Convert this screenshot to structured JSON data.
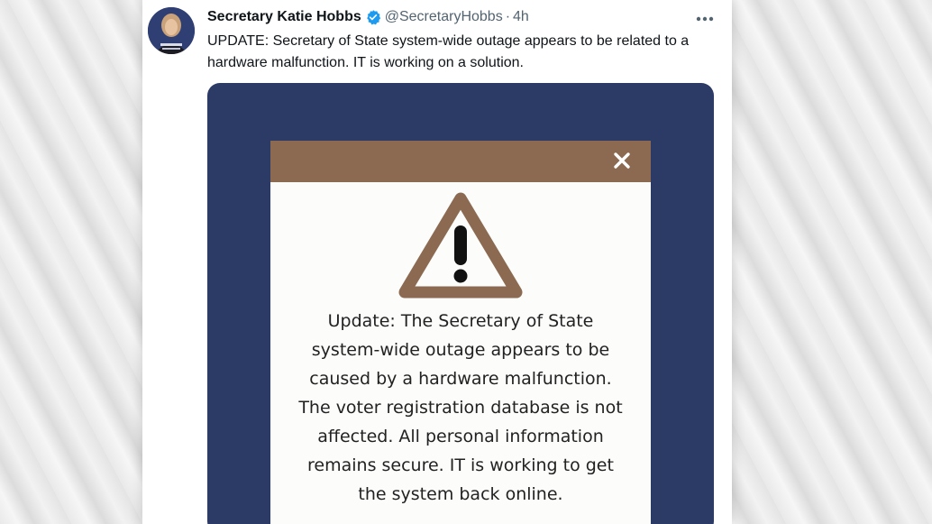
{
  "tweet": {
    "display_name": "Secretary Katie Hobbs",
    "handle": "@SecretaryHobbs",
    "separator": "·",
    "time": "4h",
    "more_icon": "more-horizontal-icon",
    "verified_icon": "verified-badge-icon",
    "text": "UPDATE: Secretary of State system-wide outage appears to be related to a hardware malfunction. IT is working on a solution."
  },
  "media": {
    "close_icon": "close-x-icon",
    "warning_icon": "warning-triangle-icon",
    "message_lines": [
      "Update: The Secretary of State",
      "system-wide outage appears to be",
      "caused by a hardware malfunction.",
      "The voter registration database is not",
      "affected. All personal information",
      "remains secure. IT is working to get",
      "the system back online."
    ]
  },
  "colors": {
    "media_background": "#2c3a66",
    "dialog_bar": "#8b6a51",
    "warning_triangle": "#8b6a51",
    "verified_blue": "#1d9bf0"
  }
}
